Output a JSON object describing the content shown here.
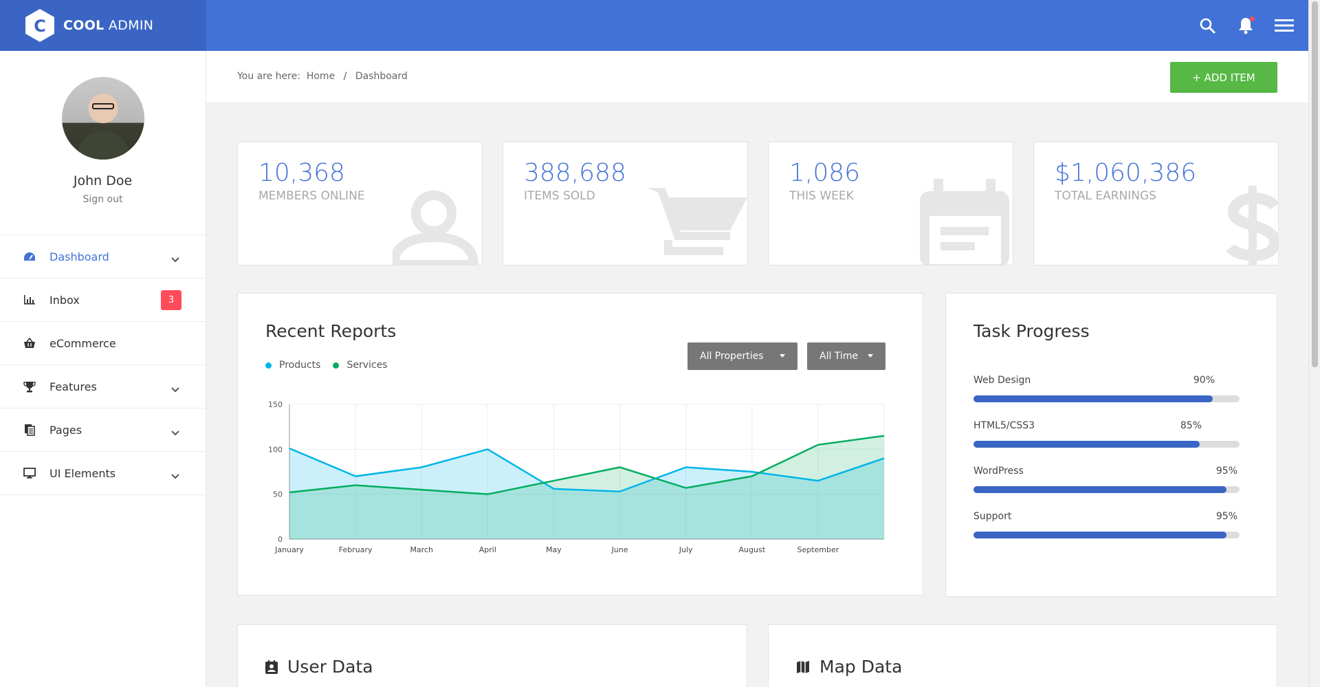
{
  "brand": {
    "bold": "COOL",
    "light": "ADMIN",
    "logo_letter": "C"
  },
  "header": {
    "icons": [
      "search-icon",
      "bell-icon",
      "menu-icon"
    ]
  },
  "profile": {
    "name": "John Doe",
    "signout": "Sign out"
  },
  "sidebar": {
    "items": [
      {
        "label": "Dashboard",
        "icon": "dashboard-icon",
        "active": true,
        "chevron": true
      },
      {
        "label": "Inbox",
        "icon": "chart-bar-icon",
        "badge": "3"
      },
      {
        "label": "eCommerce",
        "icon": "basket-icon"
      },
      {
        "label": "Features",
        "icon": "trophy-icon",
        "chevron": true
      },
      {
        "label": "Pages",
        "icon": "copy-icon",
        "chevron": true
      },
      {
        "label": "UI Elements",
        "icon": "desktop-icon",
        "chevron": true
      }
    ]
  },
  "breadcrumb": {
    "prefix": "You are here:",
    "home": "Home",
    "separator": "/",
    "current": "Dashboard"
  },
  "add_button": "+ ADD ITEM",
  "stats": [
    {
      "value": "10,368",
      "label": "MEMBERS ONLINE",
      "icon": "user-icon"
    },
    {
      "value": "388,688",
      "label": "ITEMS SOLD",
      "icon": "cart-icon"
    },
    {
      "value": "1,086",
      "label": "THIS WEEK",
      "icon": "calendar-icon"
    },
    {
      "value": "$1,060,386",
      "label": "TOTAL EARNINGS",
      "icon": "dollar-icon"
    }
  ],
  "reports": {
    "title": "Recent Reports",
    "filters": [
      "All Properties",
      "All Time"
    ],
    "legend": [
      {
        "name": "Products",
        "color": "#00b5e9"
      },
      {
        "name": "Services",
        "color": "#00ad5f"
      }
    ]
  },
  "chart_data": {
    "type": "area",
    "categories": [
      "January",
      "February",
      "March",
      "April",
      "May",
      "June",
      "July",
      "August",
      "September",
      ""
    ],
    "series": [
      {
        "name": "Products",
        "color": "#00b5e9",
        "values": [
          101,
          70,
          80,
          100,
          56,
          53,
          80,
          75,
          65,
          90
        ]
      },
      {
        "name": "Services",
        "color": "#00ad5f",
        "values": [
          52,
          60,
          55,
          50,
          65,
          80,
          57,
          70,
          105,
          115
        ]
      }
    ],
    "y_ticks": [
      0,
      50,
      100,
      150
    ],
    "ylim": [
      0,
      150
    ],
    "grid": true
  },
  "tasks": {
    "title": "Task Progress",
    "items": [
      {
        "label": "Web Design",
        "percent": 90,
        "text": "90%"
      },
      {
        "label": "HTML5/CSS3",
        "percent": 85,
        "text": "85%"
      },
      {
        "label": "WordPress",
        "percent": 95,
        "text": "95%"
      },
      {
        "label": "Support",
        "percent": 95,
        "text": "95%"
      }
    ]
  },
  "user_data": {
    "title": "User Data",
    "icon": "account-box-icon"
  },
  "map_data": {
    "title": "Map Data",
    "icon": "map-icon"
  }
}
